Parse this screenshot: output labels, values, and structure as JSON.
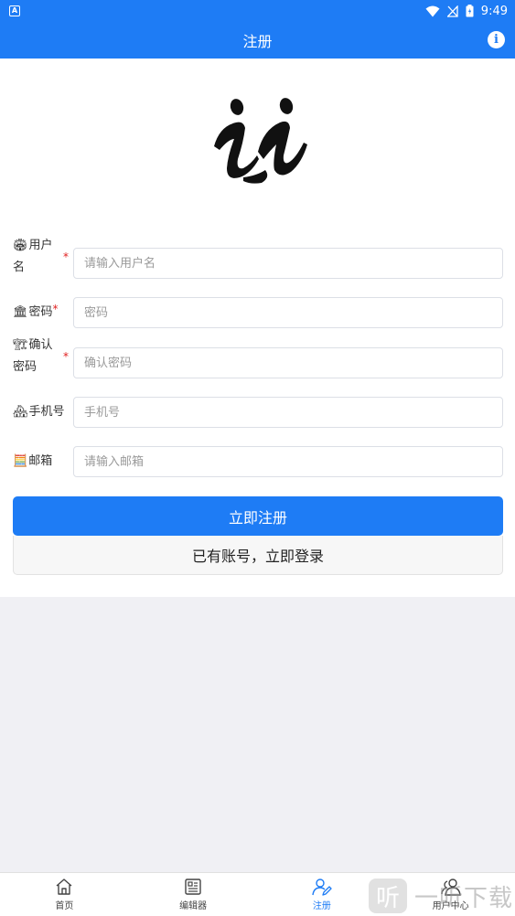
{
  "status_bar": {
    "notification": "A",
    "time": "9:49"
  },
  "header": {
    "title": "注册",
    "info_icon": "i"
  },
  "form": {
    "fields": [
      {
        "emoji": "🏟",
        "label": "用户名",
        "required": "*",
        "placeholder": "请输入用户名"
      },
      {
        "emoji": "🏛",
        "label": "密码",
        "required": "*",
        "placeholder": "密码"
      },
      {
        "emoji": "🏗",
        "label": "确认密码",
        "required": "*",
        "placeholder": "确认密码"
      },
      {
        "emoji": "🏘",
        "label": "手机号",
        "required": "",
        "placeholder": "手机号"
      },
      {
        "emoji": "🧮",
        "label": "邮箱",
        "required": "",
        "placeholder": "请输入邮箱"
      }
    ],
    "register_label": "立即注册",
    "login_label": "已有账号，立即登录"
  },
  "tabbar": {
    "tabs": [
      {
        "label": "首页",
        "icon": "home-icon"
      },
      {
        "label": "编辑器",
        "icon": "editor-icon"
      },
      {
        "label": "注册",
        "icon": "register-icon"
      },
      {
        "label": "用户中心",
        "icon": "user-center-icon"
      }
    ],
    "active_color": "#1e7cf5"
  },
  "watermark": {
    "badge": "听",
    "text": "一听下载"
  },
  "colors": {
    "primary": "#1e7cf5",
    "required": "#e02020"
  }
}
